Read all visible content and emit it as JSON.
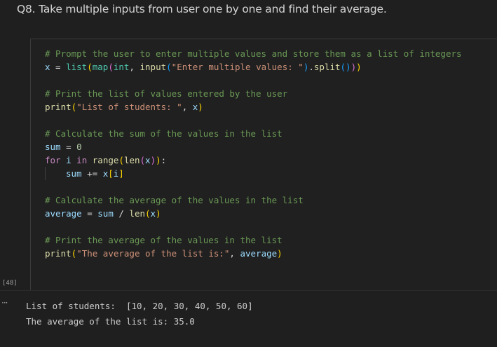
{
  "markdown": {
    "question": "Q8. Take multiple inputs from user one by one and find their average."
  },
  "code_cell": {
    "execution_count": "[48]",
    "tokens": {
      "c1": "# Prompt the user to enter multiple values and store them as a list of integers",
      "x": "x",
      "eq": " = ",
      "list": "list",
      "map": "map",
      "int": "int",
      "input": "input",
      "s_enter": "\"Enter multiple values: \"",
      "split": "split",
      "c2": "# Print the list of values entered by the user",
      "print": "print",
      "s_students": "\"List of students: \"",
      "c3": "# Calculate the sum of the values in the list",
      "sum": "sum",
      "zero": "0",
      "for": "for",
      "i": "i",
      "in": "in",
      "range": "range",
      "len": "len",
      "pluseq": " += ",
      "c4": "# Calculate the average of the values in the list",
      "average": "average",
      "div": " / ",
      "c5": "# Print the average of the values in the list",
      "s_avg": "\"The average of the list is:\""
    }
  },
  "output": {
    "toggle_label": "···",
    "lines": [
      "List of students:  [10, 20, 30, 40, 50, 60]",
      "The average of the list is: 35.0"
    ]
  }
}
